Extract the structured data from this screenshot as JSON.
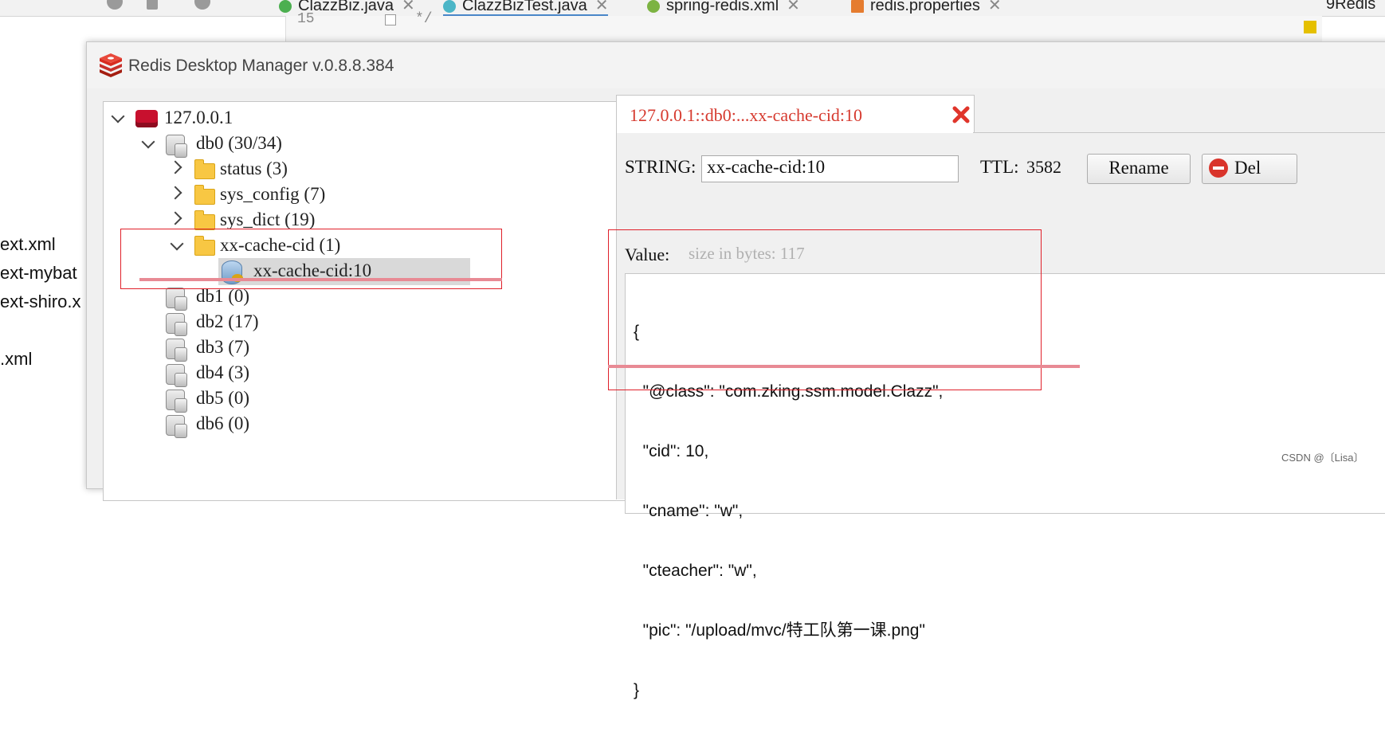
{
  "ide": {
    "tabs": [
      {
        "label": "ClazzBiz.java"
      },
      {
        "label": "ClazzBizTest.java"
      },
      {
        "label": "spring-redis.xml"
      },
      {
        "label": "redis.properties"
      }
    ],
    "right_tab_fragment": "9Redis",
    "line_number": "15",
    "comment_text": "*/",
    "project_files": [
      "ext.xml",
      "ext-mybat",
      "ext-shiro.x",
      ".xml"
    ]
  },
  "rdm": {
    "title": "Redis Desktop Manager v.0.8.8.384",
    "tree": {
      "server": "127.0.0.1",
      "db0": "db0  (30/34)",
      "namespaces": [
        "status (3)",
        "sys_config (7)",
        "sys_dict (19)",
        "xx-cache-cid (1)"
      ],
      "selected_key": "xx-cache-cid:10",
      "other_dbs": [
        "db1 (0)",
        "db2 (17)",
        "db3 (7)",
        "db4 (3)",
        "db5 (0)",
        "db6 (0)"
      ]
    },
    "tab": {
      "label": "127.0.0.1::db0:...xx-cache-cid:10"
    },
    "key_view": {
      "type_label": "STRING:",
      "key_name": "xx-cache-cid:10",
      "ttl_label": "TTL:",
      "ttl_value": "3582",
      "rename_label": "Rename",
      "delete_label": "Del",
      "value_label": "Value:",
      "size_hint": "size in bytes: 117",
      "value_lines": [
        "{",
        "  \"@class\": \"com.zking.ssm.model.Clazz\",",
        "  \"cid\": 10,",
        "  \"cname\": \"w\",",
        "  \"cteacher\": \"w\",",
        "  \"pic\": \"/upload/mvc/特工队第一课.png\"",
        "}"
      ]
    }
  },
  "watermark": "CSDN @〔Lisa〕",
  "colors": {
    "accent_red": "#d63a2f",
    "annotation_red": "#e0202a",
    "annotation_pink": "#e88a94"
  }
}
